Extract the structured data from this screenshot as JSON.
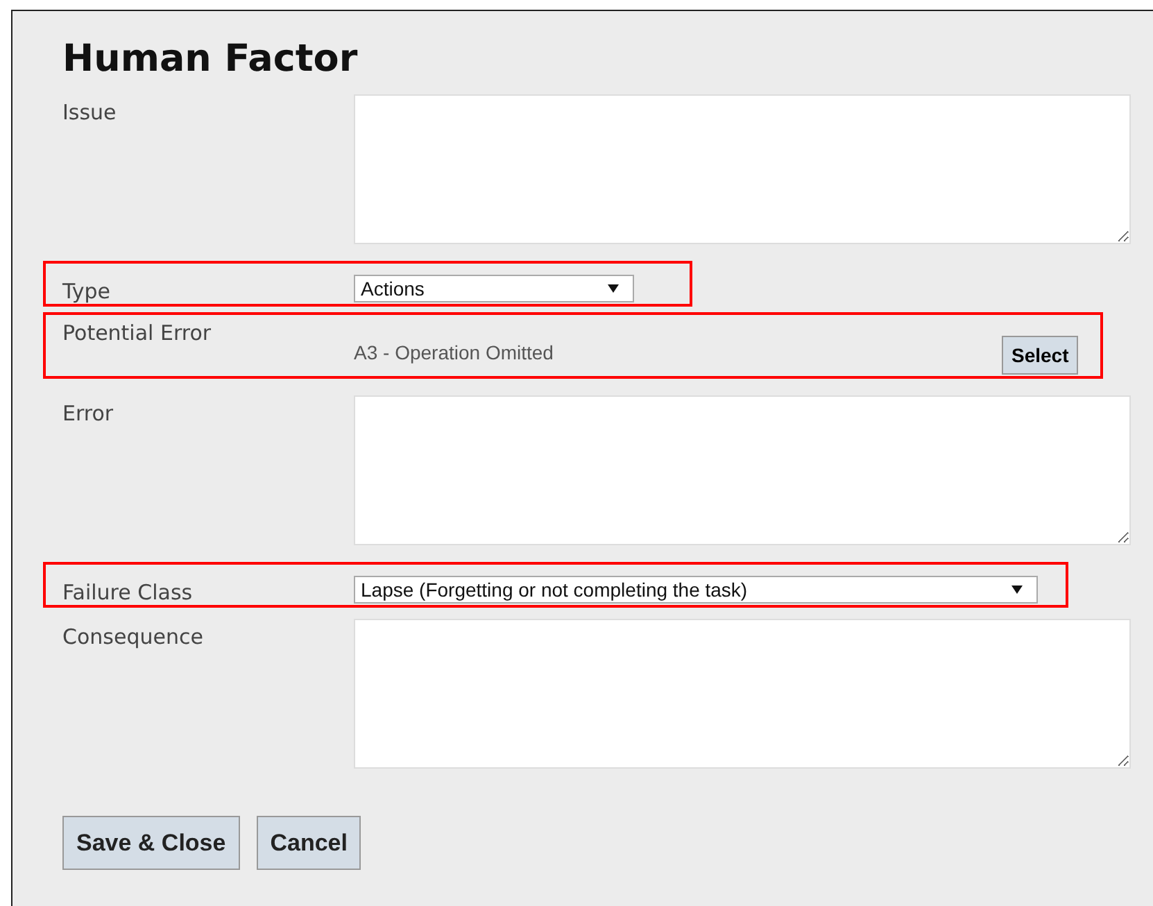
{
  "title": "Human Factor",
  "fields": [
    {
      "label": "Issue",
      "kind": "textarea",
      "highlighted": false
    },
    {
      "label": "Type",
      "kind": "select",
      "value": "Actions",
      "highlighted": true
    },
    {
      "label": "Potential Error",
      "kind": "picker",
      "value": "A3 - Operation Omitted",
      "button": "Select",
      "highlighted": true
    },
    {
      "label": "Error",
      "kind": "textarea",
      "highlighted": false
    },
    {
      "label": "Failure Class",
      "kind": "select",
      "value": "Lapse (Forgetting or not completing the task)",
      "highlighted": true
    },
    {
      "label": "Consequence",
      "kind": "textarea",
      "highlighted": false
    }
  ],
  "buttons": [
    "Save & Close",
    "Cancel"
  ]
}
